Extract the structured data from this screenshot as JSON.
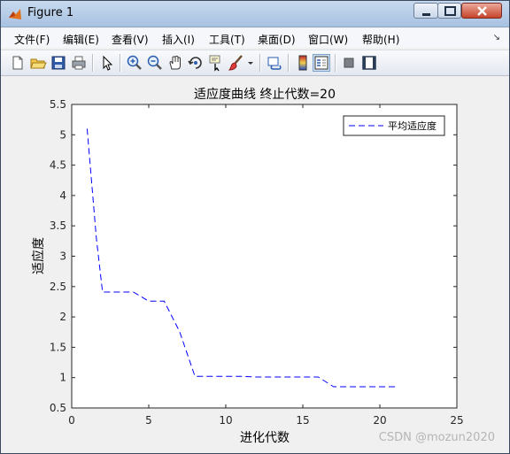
{
  "window": {
    "title": "Figure 1"
  },
  "menu": [
    "文件(F)",
    "编辑(E)",
    "查看(V)",
    "插入(I)",
    "工具(T)",
    "桌面(D)",
    "窗口(W)",
    "帮助(H)"
  ],
  "toolbar_icons": [
    "new-figure-icon",
    "open-file-icon",
    "save-icon",
    "print-icon",
    "pointer-icon",
    "zoom-in-icon",
    "zoom-out-icon",
    "pan-icon",
    "rotate-icon",
    "data-cursor-icon",
    "brush-icon",
    "brush-dropdown-icon",
    "link-icon",
    "colorbar-icon",
    "legend-icon",
    "hide-plot-tools-icon",
    "show-plot-tools-icon"
  ],
  "chart_data": {
    "type": "line",
    "title": "适应度曲线  终止代数=20",
    "xlabel": "进化代数",
    "ylabel": "适应度",
    "xlim": [
      0,
      25
    ],
    "ylim": [
      0.5,
      5.5
    ],
    "xticks": [
      0,
      5,
      10,
      15,
      20,
      25
    ],
    "yticks": [
      0.5,
      1,
      1.5,
      2,
      2.5,
      3,
      3.5,
      4,
      4.5,
      5,
      5.5
    ],
    "legend_position": "top-right",
    "series": [
      {
        "name": "平均适应度",
        "color": "#0000ff",
        "style": "dashed",
        "x": [
          1,
          1.6,
          2,
          3,
          4,
          5,
          6,
          7,
          8,
          9,
          10,
          11,
          12,
          13,
          14,
          15,
          16,
          17,
          18,
          19,
          20,
          21
        ],
        "y": [
          5.1,
          3.3,
          2.41,
          2.41,
          2.41,
          2.26,
          2.26,
          1.76,
          1.02,
          1.02,
          1.02,
          1.02,
          1.01,
          1.01,
          1.01,
          1.01,
          1.01,
          0.85,
          0.85,
          0.85,
          0.85,
          0.85
        ]
      }
    ]
  },
  "watermark": "CSDN @mozun2020"
}
